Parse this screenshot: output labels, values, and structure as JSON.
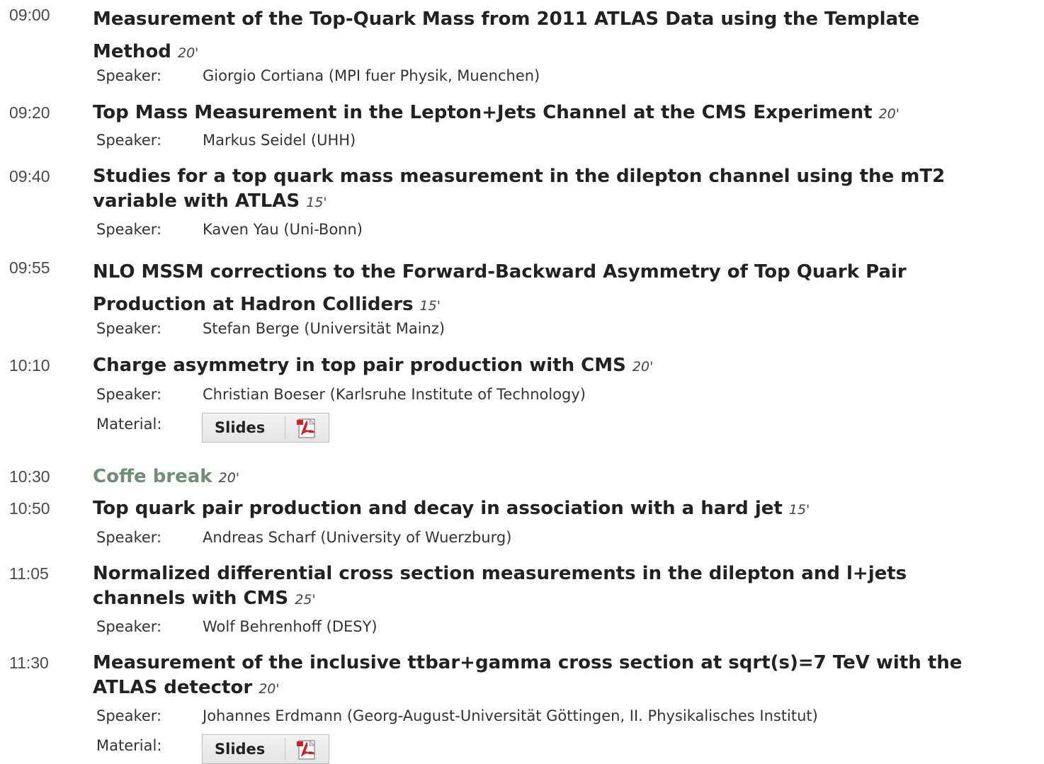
{
  "labels": {
    "speaker": "Speaker:",
    "material": "Material:",
    "slides": "Slides"
  },
  "icons": {
    "pdf": "pdf-icon"
  },
  "colors": {
    "title": "#222222",
    "break_title": "#6e8f75",
    "time": "#4a4a4a"
  },
  "entries": [
    {
      "time": "09:00",
      "title_line1": "Measurement of the Top-Quark Mass from 2011 ATLAS Data using the Template",
      "title_line2": "Method",
      "duration": "20'",
      "speaker": "Giorgio Cortiana (MPI fuer Physik, Muenchen)"
    },
    {
      "time": "09:20",
      "title": "Top Mass Measurement in the Lepton+Jets Channel at the CMS Experiment",
      "duration": "20'",
      "speaker": "Markus Seidel (UHH)"
    },
    {
      "time": "09:40",
      "title_line1": "Studies for a top quark mass measurement in the dilepton channel using the mT2",
      "title_line2": "variable with ATLAS",
      "duration": "15'",
      "speaker": "Kaven Yau (Uni-Bonn)"
    },
    {
      "time": "09:55",
      "title_line1": "NLO MSSM corrections to the Forward-Backward Asymmetry of Top Quark Pair",
      "title_line2": "Production at Hadron Colliders",
      "duration": "15'",
      "speaker": "Stefan Berge (Universität Mainz)"
    },
    {
      "time": "10:10",
      "title": "Charge asymmetry in top pair production with CMS",
      "duration": "20'",
      "speaker": "Christian Boeser (Karlsruhe Institute of Technology)"
    },
    {
      "time": "10:30",
      "title": "Coffe break",
      "duration": "20'"
    },
    {
      "time": "10:50",
      "title": "Top quark pair production and decay in association with a hard jet",
      "duration": "15'",
      "speaker": "Andreas Scharf (University of Wuerzburg)"
    },
    {
      "time": "11:05",
      "title_line1": "Normalized differential cross section measurements in the dilepton and l+jets",
      "title_line2": "channels with CMS",
      "duration": "25'",
      "speaker": "Wolf Behrenhoff (DESY)"
    },
    {
      "time": "11:30",
      "title_line1": "Measurement of the inclusive ttbar+gamma cross section at sqrt(s)=7 TeV with the",
      "title_line2": "ATLAS detector",
      "duration": "20'",
      "speaker": "Johannes Erdmann (Georg-August-Universität Göttingen, II. Physikalisches Institut)"
    }
  ]
}
